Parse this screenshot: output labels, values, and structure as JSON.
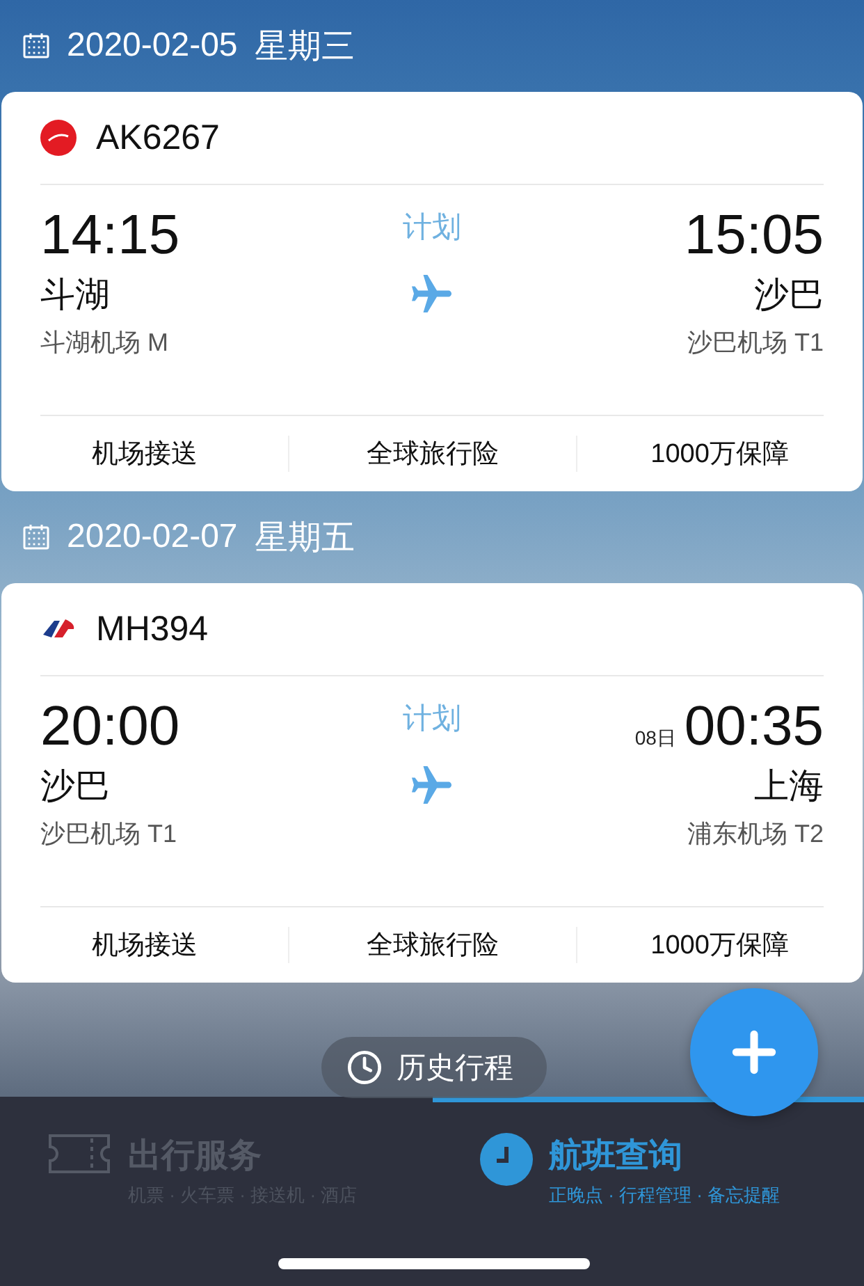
{
  "trips": [
    {
      "date": "2020-02-05",
      "weekday": "星期三",
      "flight": {
        "kind": "airasia",
        "number": "AK6267",
        "status": "计划",
        "departure": {
          "time": "14:15",
          "city": "斗湖",
          "airport": "斗湖机场 M"
        },
        "arrival": {
          "time": "15:05",
          "city": "沙巴",
          "airport": "沙巴机场 T1"
        }
      },
      "services": [
        "机场接送",
        "全球旅行险",
        "1000万保障"
      ]
    },
    {
      "date": "2020-02-07",
      "weekday": "星期五",
      "flight": {
        "kind": "malaysia",
        "number": "MH394",
        "status": "计划",
        "departure": {
          "time": "20:00",
          "city": "沙巴",
          "airport": "沙巴机场 T1"
        },
        "arrival": {
          "day": "08日",
          "time": "00:35",
          "city": "上海",
          "airport": "浦东机场 T2"
        }
      },
      "services": [
        "机场接送",
        "全球旅行险",
        "1000万保障"
      ]
    }
  ],
  "history_button": {
    "label": "历史行程"
  },
  "tabs": [
    {
      "kind": "ticket",
      "title": "出行服务",
      "subtitle": "机票 · 火车票 · 接送机 · 酒店",
      "selected": false
    },
    {
      "kind": "clock",
      "title": "航班查询",
      "subtitle": "正晚点 · 行程管理 · 备忘提醒",
      "selected": true
    }
  ]
}
